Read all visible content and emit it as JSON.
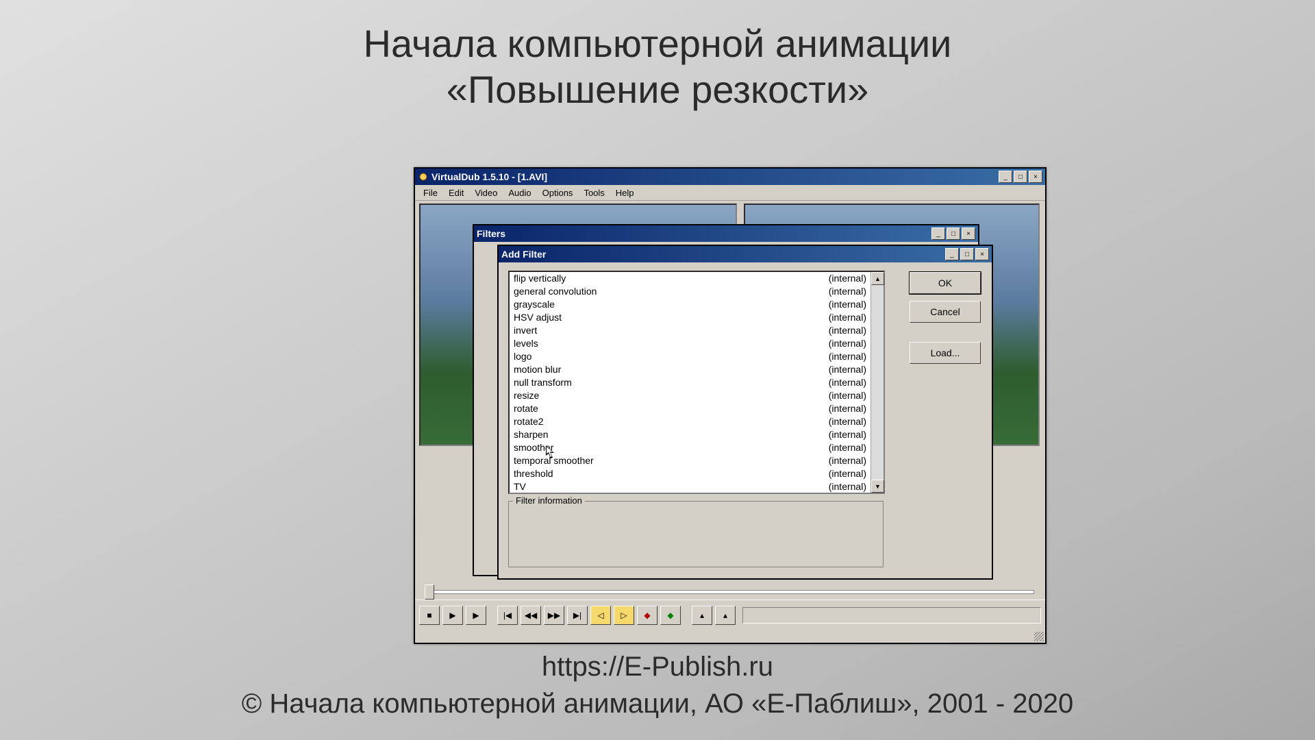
{
  "slide": {
    "title_line1": "Начала компьютерной анимации",
    "title_line2": "«Повышение резкости»",
    "url": "https://E-Publish.ru",
    "copyright": "© Начала компьютерной анимации, АО «Е-Паблиш», 2001 - 2020"
  },
  "main_window": {
    "title": "VirtualDub 1.5.10 - [1.AVI]",
    "menu": [
      "File",
      "Edit",
      "Video",
      "Audio",
      "Options",
      "Tools",
      "Help"
    ],
    "win_buttons": {
      "min": "_",
      "max": "□",
      "close": "×"
    }
  },
  "filters_window": {
    "title": "Filters",
    "win_buttons": {
      "min": "_",
      "max": "□",
      "close": "×"
    }
  },
  "addfilter_window": {
    "title": "Add Filter",
    "win_buttons": {
      "min": "_",
      "max": "□",
      "close": "×"
    },
    "buttons": {
      "ok": "OK",
      "cancel": "Cancel",
      "load": "Load..."
    },
    "info_label": "Filter information",
    "scroll": {
      "up": "▲",
      "down": "▼"
    },
    "filters": [
      {
        "name": "flip vertically",
        "source": "(internal)"
      },
      {
        "name": "general convolution",
        "source": "(internal)"
      },
      {
        "name": "grayscale",
        "source": "(internal)"
      },
      {
        "name": "HSV adjust",
        "source": "(internal)"
      },
      {
        "name": "invert",
        "source": "(internal)"
      },
      {
        "name": "levels",
        "source": "(internal)"
      },
      {
        "name": "logo",
        "source": "(internal)"
      },
      {
        "name": "motion blur",
        "source": "(internal)"
      },
      {
        "name": "null transform",
        "source": "(internal)"
      },
      {
        "name": "resize",
        "source": "(internal)"
      },
      {
        "name": "rotate",
        "source": "(internal)"
      },
      {
        "name": "rotate2",
        "source": "(internal)"
      },
      {
        "name": "sharpen",
        "source": "(internal)"
      },
      {
        "name": "smoother",
        "source": "(internal)"
      },
      {
        "name": "temporal smoother",
        "source": "(internal)"
      },
      {
        "name": "threshold",
        "source": "(internal)"
      },
      {
        "name": "TV",
        "source": "(internal)"
      }
    ]
  },
  "toolbar_icons": {
    "stop": "■",
    "play": "▶",
    "play_out": "▶",
    "first": "|◀",
    "back": "◀◀",
    "fwd": "▶▶",
    "last": "▶|",
    "key_prev": "◁",
    "key_next": "▷",
    "scene_prev": "◆",
    "scene_next": "◆",
    "mark_in": "▴",
    "mark_out": "▴"
  }
}
